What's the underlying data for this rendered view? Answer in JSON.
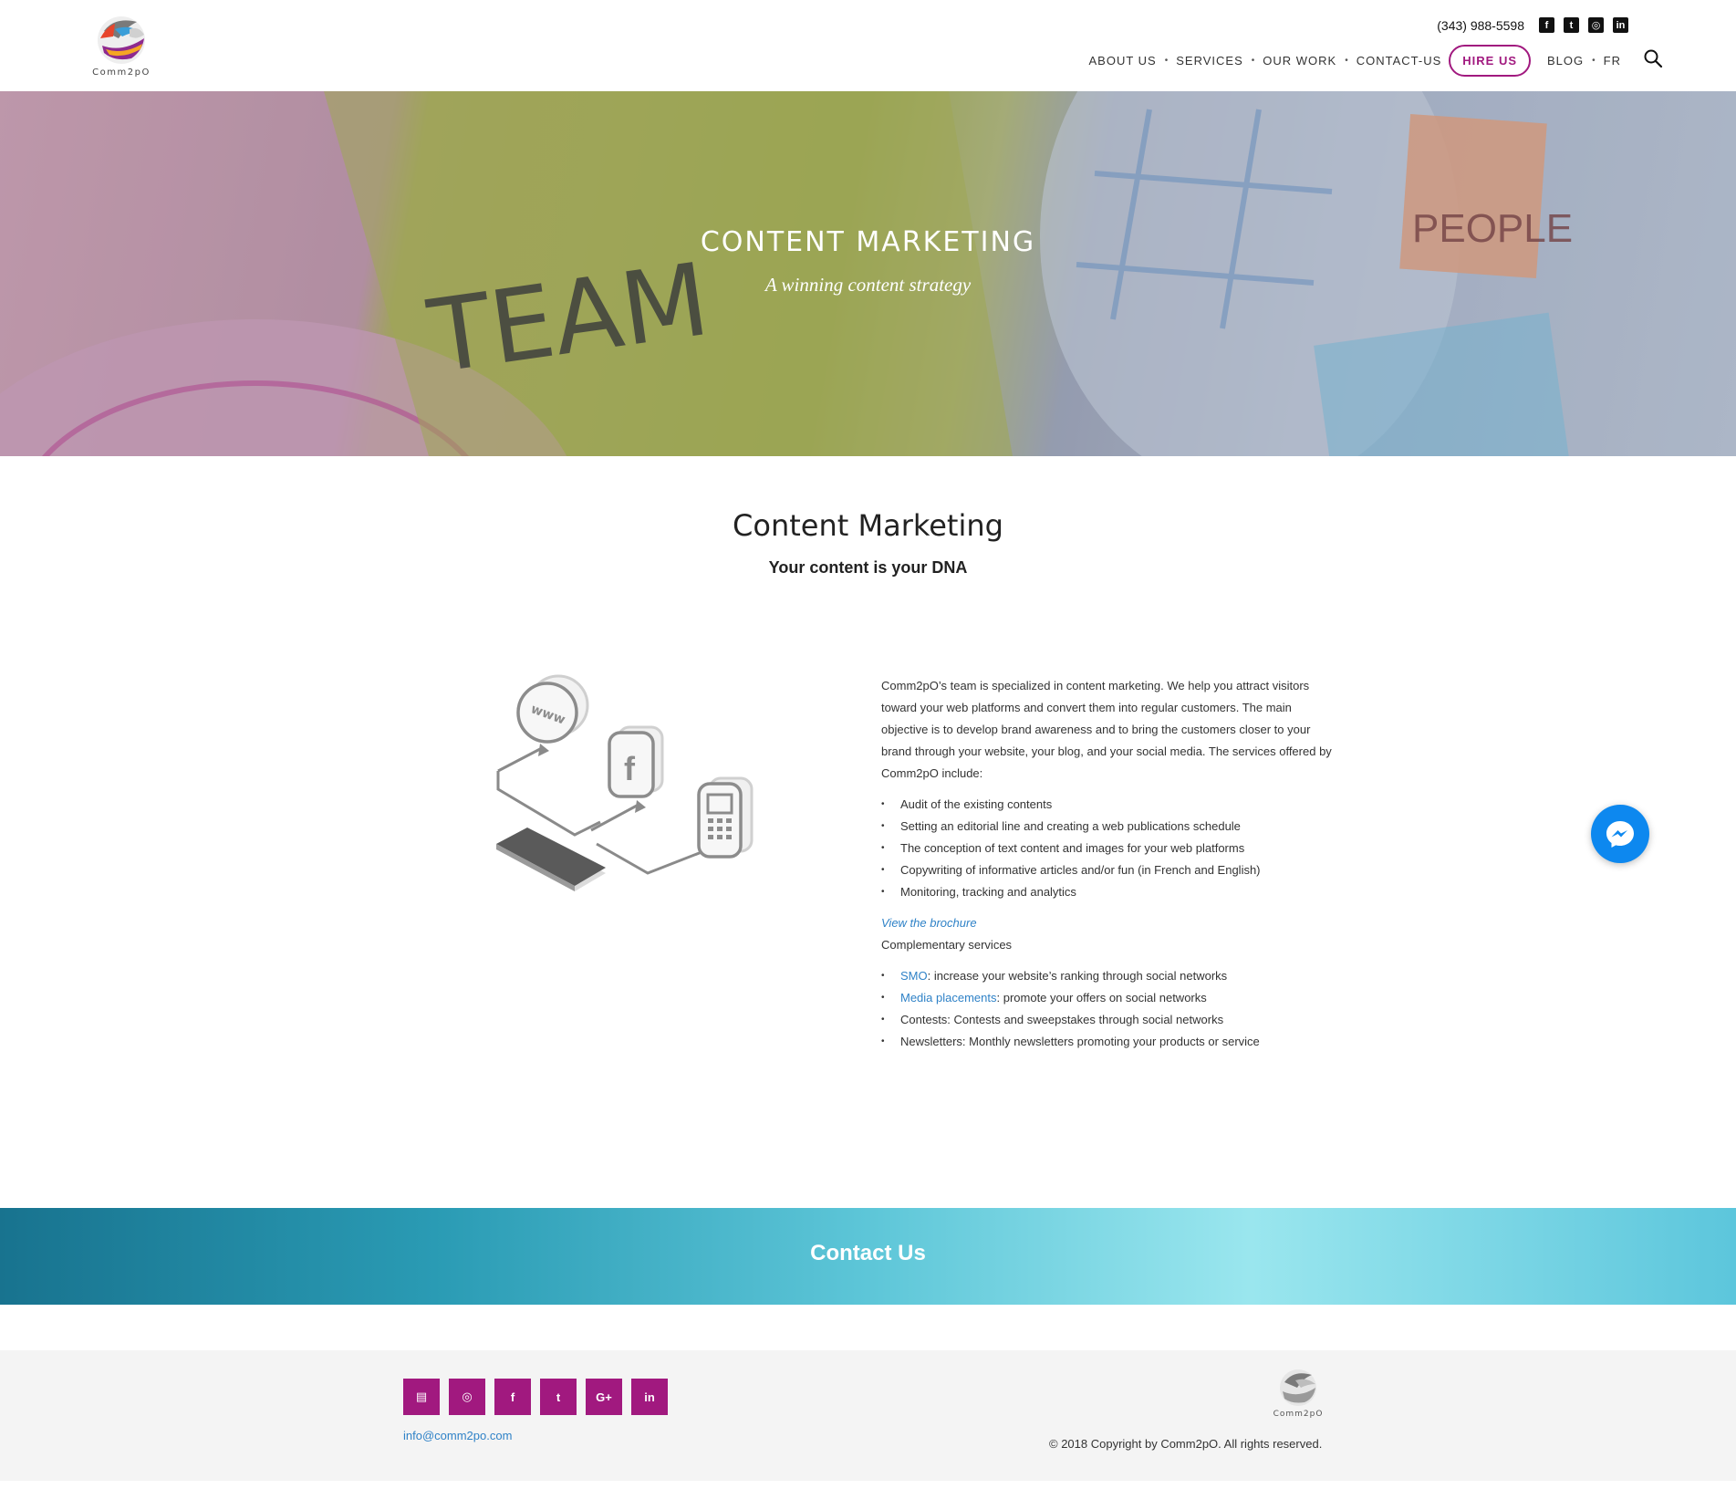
{
  "header": {
    "logo_text": "Comm2pO",
    "phone": "(343) 988-5598",
    "social_icons": [
      "facebook-icon",
      "twitter-icon",
      "instagram-icon",
      "linkedin-icon"
    ],
    "nav": {
      "about": "ABOUT US",
      "services": "SERVICES",
      "work": "OUR WORK",
      "contact": "CONTACT-US",
      "hire": "HIRE US",
      "blog": "BLOG",
      "lang": "FR"
    }
  },
  "hero": {
    "title": "CONTENT MARKETING",
    "subtitle": "A winning content strategy",
    "image_text": {
      "team": "TEAM",
      "people": "PEOPLE"
    }
  },
  "intro": {
    "title": "Content Marketing",
    "subtitle": "Your content is your DNA"
  },
  "content": {
    "paragraph": "Comm2pO’s team is specialized in content marketing. We help you attract visitors toward your web platforms and convert them into regular customers. The main objective is to develop brand awareness and to bring the customers closer to your brand through your website, your blog, and your social media. The services offered by Comm2pO include:",
    "services": [
      "Audit of the existing contents",
      "Setting an editorial line and creating a web publications schedule",
      "The conception of text content and images for your web platforms",
      "Copywriting of informative articles and/or fun (in French and English)",
      "Monitoring, tracking and analytics"
    ],
    "brochure_link": "View the brochure",
    "complementary_title": "Complementary services",
    "complementary": [
      {
        "link": "SMO",
        "text": ": increase your website’s ranking through social networks"
      },
      {
        "link": "Media placements",
        "text": ": promote your offers on social networks"
      },
      {
        "link": "",
        "text": "Contests: Contests and sweepstakes through social networks"
      },
      {
        "link": "",
        "text": "Newsletters: Monthly newsletters promoting your products or service"
      }
    ]
  },
  "contact_band": {
    "title": "Contact Us"
  },
  "footer": {
    "social_icons": [
      "newsletter-icon",
      "instagram-icon",
      "facebook-icon",
      "twitter-icon",
      "google-plus-icon",
      "linkedin-icon"
    ],
    "social_glyphs": [
      "▤",
      "◎",
      "f",
      "t",
      "G+",
      "in"
    ],
    "email": "info@comm2po.com",
    "logo_text": "Comm2pO",
    "copyright": "© 2018 Copyright by Comm2pO. All rights reserved."
  },
  "colors": {
    "accent": "#a1197f",
    "link": "#2f82c7",
    "messenger": "#0d88ef"
  }
}
